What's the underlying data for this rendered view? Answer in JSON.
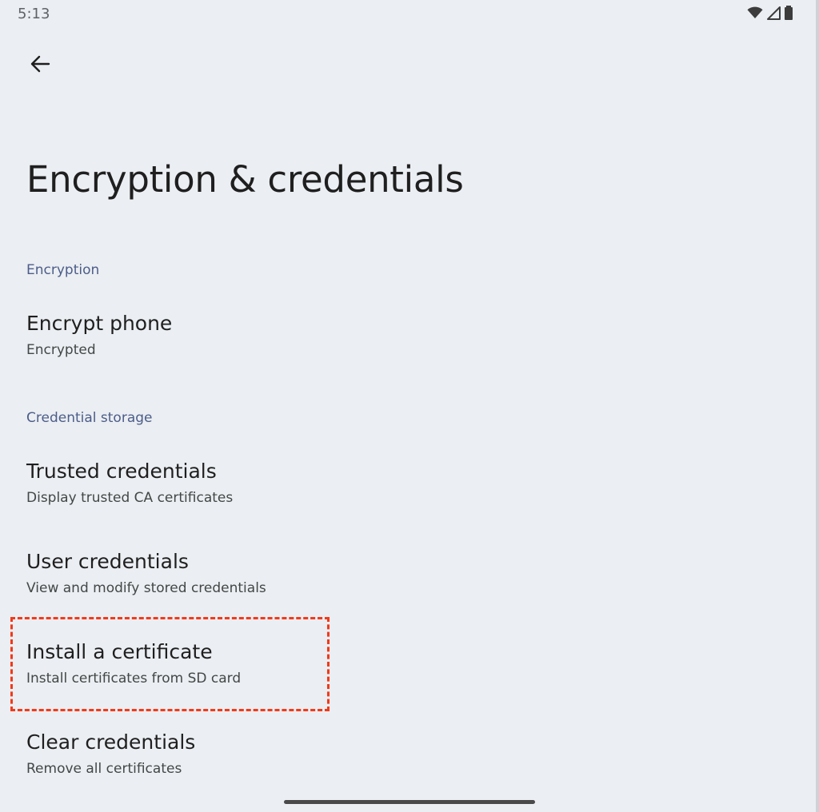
{
  "status_bar": {
    "time": "5:13",
    "icons": [
      "wifi-icon",
      "cell-signal-icon",
      "battery-icon"
    ]
  },
  "toolbar": {
    "back_icon": "arrow-back-icon"
  },
  "page": {
    "title": "Encryption & credentials"
  },
  "sections": {
    "encryption": {
      "header": "Encryption",
      "items": [
        {
          "title": "Encrypt phone",
          "summary": "Encrypted"
        }
      ]
    },
    "credential_storage": {
      "header": "Credential storage",
      "items": [
        {
          "title": "Trusted credentials",
          "summary": "Display trusted CA certificates"
        },
        {
          "title": "User credentials",
          "summary": "View and modify stored credentials"
        },
        {
          "title": "Install a certificate",
          "summary": "Install certificates from SD card"
        },
        {
          "title": "Clear credentials",
          "summary": "Remove all certificates"
        }
      ]
    }
  },
  "colors": {
    "background": "#ebeef2",
    "section_header": "#4c5d8a",
    "highlight": "#f13a1a"
  }
}
